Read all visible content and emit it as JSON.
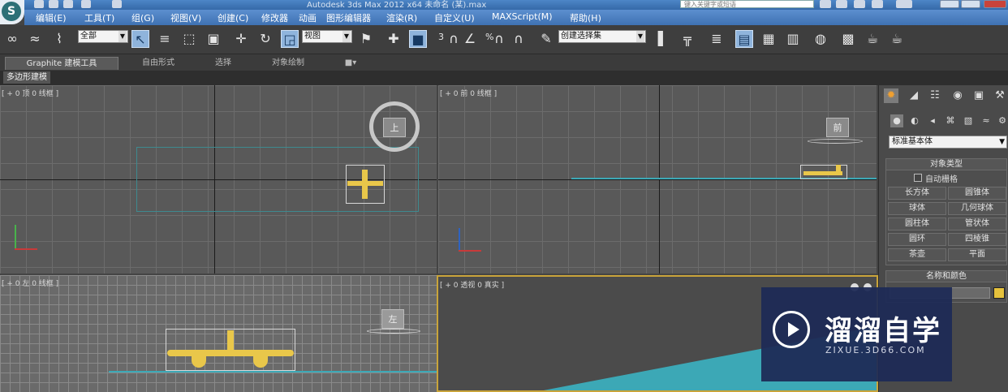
{
  "titlebar": {
    "title": "Autodesk 3ds Max 2012 x64      未命名 (某).max",
    "search_placeholder": "键入关键字或短语"
  },
  "menu": [
    {
      "label": "编辑(E)"
    },
    {
      "label": "工具(T)"
    },
    {
      "label": "组(G)"
    },
    {
      "label": "视图(V)"
    },
    {
      "label": "创建(C)"
    },
    {
      "label": "修改器"
    },
    {
      "label": "动画"
    },
    {
      "label": "图形编辑器"
    },
    {
      "label": "渲染(R)"
    },
    {
      "label": "自定义(U)"
    },
    {
      "label": "MAXScript(M)"
    },
    {
      "label": "帮助(H)"
    }
  ],
  "toolbar": {
    "selection_filter": "全部",
    "ref_coord_system": "视图",
    "named_selection_sets": "创建选择集",
    "snap_angle_label": "3",
    "percent_snap_label": "%"
  },
  "ribbon": {
    "tabs": [
      {
        "label": "Graphite 建模工具"
      },
      {
        "label": "自由形式"
      },
      {
        "label": "选择"
      },
      {
        "label": "对象绘制"
      }
    ],
    "panel_label": "多边形建模"
  },
  "viewports": {
    "top": {
      "label": "[ + 0 顶 0 线框 ]",
      "gizmo": "上"
    },
    "front": {
      "label": "[ + 0 前 0 线框 ]",
      "gizmo": "前"
    },
    "left": {
      "label": "[ + 0 左 0 线框 ]",
      "gizmo": "左"
    },
    "perspective": {
      "label": "[ + 0 透视 0 真实 ]"
    }
  },
  "command_panel": {
    "category_dropdown": "标准基本体",
    "object_type_title": "对象类型",
    "autogrid_label": "自动栅格",
    "object_buttons": [
      {
        "label": "长方体"
      },
      {
        "label": "圆锥体"
      },
      {
        "label": "球体"
      },
      {
        "label": "几何球体"
      },
      {
        "label": "圆柱体"
      },
      {
        "label": "管状体"
      },
      {
        "label": "圆环"
      },
      {
        "label": "四棱锥"
      },
      {
        "label": "茶壶"
      },
      {
        "label": "平面"
      }
    ],
    "name_color_title": "名称和颜色",
    "object_color": "#e6c23c"
  },
  "watermark": {
    "title": "溜溜自学",
    "url": "ZIXUE.3D66.COM"
  },
  "colors": {
    "viewport_bg": "#595959",
    "grid": "#6c6c6c",
    "plane": "#e9c74a",
    "teal": "#3ca8b6",
    "watermark_bg": "#1e2b56"
  }
}
